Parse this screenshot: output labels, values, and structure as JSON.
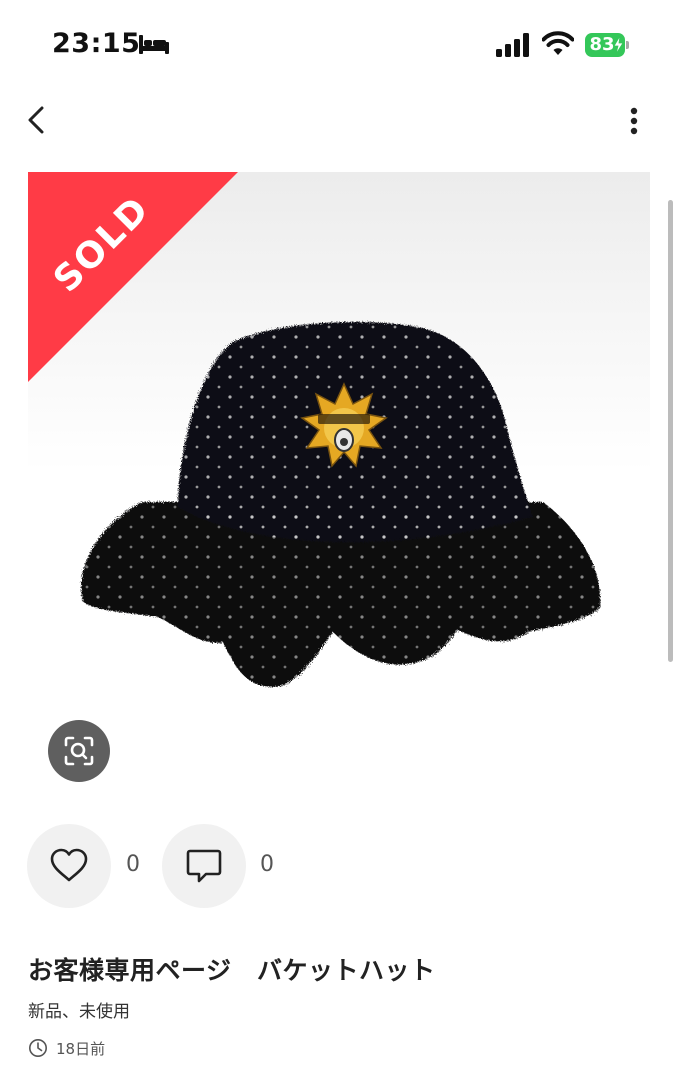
{
  "status_bar": {
    "time": "23:15",
    "battery_level": "83",
    "battery_color": "#34c759"
  },
  "nav": {
    "back_icon": "chevron-left-icon",
    "more_icon": "vertical-ellipsis-icon"
  },
  "product": {
    "sold_label": "SOLD",
    "sold_color": "#ff3b46",
    "image_description_icon": "image-search-icon"
  },
  "actions": {
    "likes": "0",
    "comments": "0",
    "like_icon": "heart-icon",
    "comment_icon": "speech-bubble-icon"
  },
  "item": {
    "title": "お客様専用ページ　バケットハット",
    "condition": "新品、未使用",
    "posted": "18日前"
  }
}
